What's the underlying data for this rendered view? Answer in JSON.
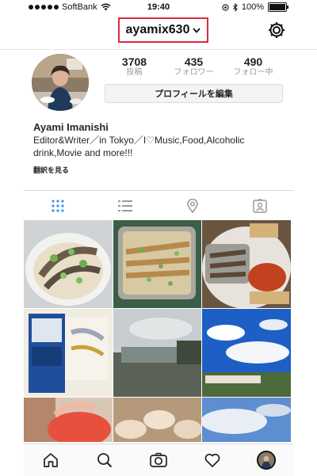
{
  "status_bar": {
    "carrier": "SoftBank",
    "time": "19:40",
    "battery_percent": "100%",
    "icons": [
      "signal-dots-icon",
      "wifi-icon",
      "location-icon",
      "bluetooth-icon",
      "battery-icon"
    ]
  },
  "header": {
    "username": "ayamix630",
    "dropdown_icon": "chevron-down-icon",
    "settings_icon": "gear-icon",
    "highlight_color": "#e0283c"
  },
  "profile": {
    "stats": [
      {
        "value": "3708",
        "label": "投稿"
      },
      {
        "value": "435",
        "label": "フォロワー"
      },
      {
        "value": "490",
        "label": "フォロー中"
      }
    ],
    "edit_button": "プロフィールを編集",
    "full_name": "Ayami Imanishi",
    "bio_line1": "Editor&Writer／in Tokyo／I♡Music,Food,Alcoholic",
    "bio_line2": "drink,Movie and more!!!",
    "translate_link": "翻訳を見る"
  },
  "tabs": {
    "items": [
      "grid-icon",
      "list-icon",
      "location-pin-icon",
      "tagged-person-icon"
    ],
    "active_color": "#3897f0",
    "inactive_color": "#999999"
  },
  "bottom_nav": {
    "items": [
      "home-icon",
      "search-icon",
      "camera-icon",
      "heart-icon",
      "profile-avatar"
    ]
  }
}
